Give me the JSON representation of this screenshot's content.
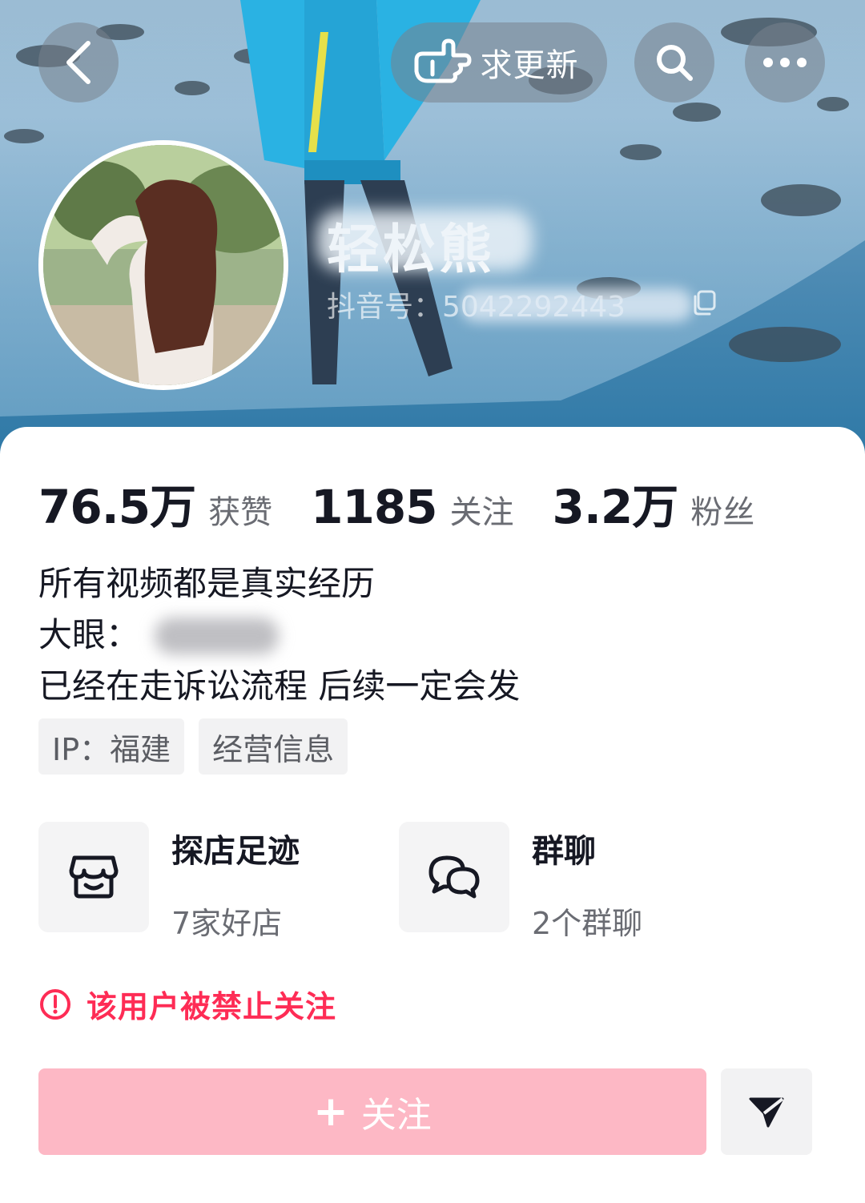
{
  "header": {
    "update_label": "求更新"
  },
  "profile": {
    "nickname": "轻松熊",
    "douyin_id": "抖音号：5042292443"
  },
  "stats": [
    {
      "value": "76.5万",
      "label": "获赞"
    },
    {
      "value": "1185",
      "label": "关注"
    },
    {
      "value": "3.2万",
      "label": "粉丝"
    }
  ],
  "bio": {
    "line1": "所有视频都是真实经历",
    "line2": "大眼：",
    "line3": "已经在走诉讼流程 后续一定会发"
  },
  "tags": {
    "ip": "IP：福建",
    "business": "经营信息"
  },
  "features": {
    "store": {
      "title": "探店足迹",
      "subtitle": "7家好店"
    },
    "group": {
      "title": "群聊",
      "subtitle": "2个群聊"
    }
  },
  "notice": {
    "banned": "该用户被禁止关注"
  },
  "actions": {
    "follow_plus": "+",
    "follow_label": "关注"
  },
  "colors": {
    "accent": "#fe2c55",
    "follow_disabled": "#fdb8c5"
  },
  "icons": [
    "back-icon",
    "pointing-hand-icon",
    "search-icon",
    "more-icon",
    "copy-icon",
    "store-icon",
    "chat-bubbles-icon",
    "warning-icon",
    "send-icon"
  ]
}
